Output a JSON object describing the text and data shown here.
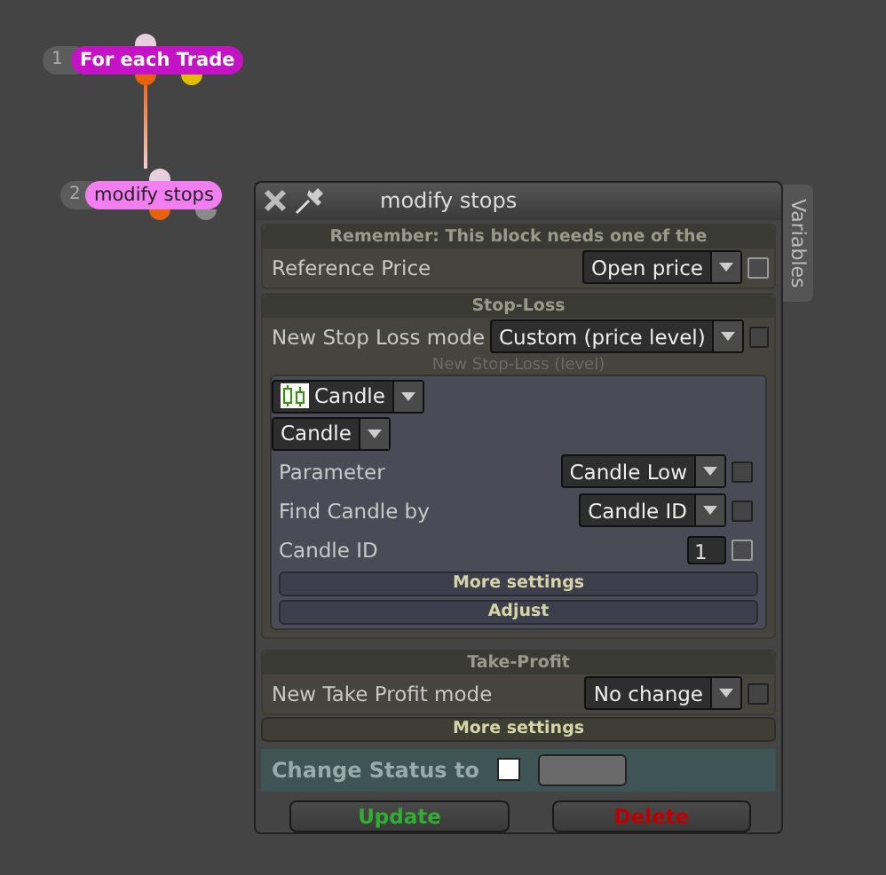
{
  "nodes": [
    {
      "number": "1",
      "label": "For each Trade",
      "color": "#c413c4",
      "outputs": [
        {
          "color": "#e8620c"
        },
        {
          "color": "#e3be00"
        }
      ]
    },
    {
      "number": "2",
      "label": "modify stops",
      "color": "#f27ef2",
      "outputs": [
        {
          "color": "#e8620c"
        },
        {
          "color": "#8a8a8a"
        }
      ]
    }
  ],
  "panel": {
    "title": "modify stops",
    "side_tab": "Variables",
    "notice": "Remember: This block needs one of the",
    "reference": {
      "label": "Reference Price",
      "value": "Open price",
      "checked": false,
      "disabled": false
    },
    "stop_loss": {
      "header": "Stop-Loss",
      "mode": {
        "label": "New Stop Loss mode",
        "value": "Custom (price level)",
        "checked": false,
        "disabled": true
      },
      "sublabel": "New Stop-Loss (level)",
      "source": "Candle",
      "source_type": "Candle",
      "fields": [
        {
          "kind": "dropdown",
          "label": "Parameter",
          "value": "Candle Low",
          "checked": false,
          "disabled": true
        },
        {
          "kind": "dropdown",
          "label": "Find Candle by",
          "value": "Candle ID",
          "checked": false,
          "disabled": true
        },
        {
          "kind": "input",
          "label": "Candle ID",
          "value": "1",
          "checked": false,
          "disabled": false
        }
      ],
      "buttons": [
        "More settings",
        "Adjust"
      ]
    },
    "take_profit": {
      "header": "Take-Profit",
      "mode": {
        "label": "New Take Profit mode",
        "value": "No change",
        "checked": false,
        "disabled": true
      }
    },
    "more_settings": "More settings",
    "status": {
      "label": "Change Status to",
      "checked": false
    },
    "actions": [
      {
        "label": "Update",
        "kind": "update"
      },
      {
        "label": "Delete",
        "kind": "delete"
      }
    ]
  }
}
